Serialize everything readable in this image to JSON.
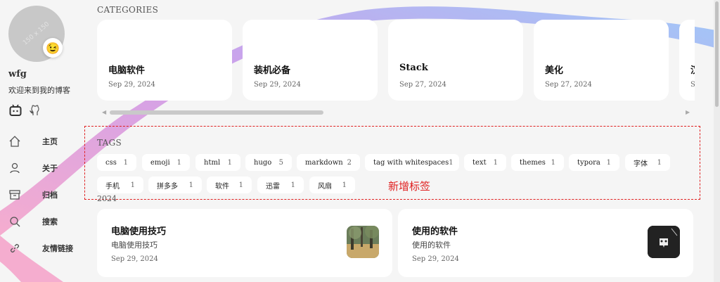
{
  "sidebar": {
    "avatar_placeholder": "150 x 150",
    "emoji": "😉",
    "site_name": "wfg",
    "site_desc": "欢迎来到我的博客",
    "social_icons": [
      "bilibili-icon",
      "github-icon"
    ],
    "nav": [
      {
        "label": "主页",
        "icon": "home-icon"
      },
      {
        "label": "关于",
        "icon": "user-icon"
      },
      {
        "label": "归档",
        "icon": "archive-icon"
      },
      {
        "label": "搜索",
        "icon": "search-icon"
      },
      {
        "label": "友情链接",
        "icon": "link-icon"
      }
    ]
  },
  "categories": {
    "heading": "CATEGORIES",
    "cards": [
      {
        "title": "电脑软件",
        "date": "Sep 29, 2024"
      },
      {
        "title": "装机必备",
        "date": "Sep 29, 2024"
      },
      {
        "title": "Stack",
        "date": "Sep 27, 2024"
      },
      {
        "title": "美化",
        "date": "Sep 27, 2024"
      },
      {
        "title": "汉",
        "date": "S"
      }
    ]
  },
  "tags": {
    "heading": "TAGS",
    "items": [
      {
        "name": "css",
        "count": "1"
      },
      {
        "name": "emoji",
        "count": "1"
      },
      {
        "name": "html",
        "count": "1"
      },
      {
        "name": "hugo",
        "count": "5"
      },
      {
        "name": "markdown",
        "count": "2"
      },
      {
        "name": "tag with whitespaces",
        "count": "1"
      },
      {
        "name": "text",
        "count": "1"
      },
      {
        "name": "themes",
        "count": "1"
      },
      {
        "name": "typora",
        "count": "1"
      },
      {
        "name": "字体",
        "count": "1"
      },
      {
        "name": "手机",
        "count": "1"
      },
      {
        "name": "拼多多",
        "count": "1"
      },
      {
        "name": "软件",
        "count": "1"
      },
      {
        "name": "迅雷",
        "count": "1"
      },
      {
        "name": "风扇",
        "count": "1"
      }
    ],
    "annotation": "新增标签"
  },
  "archive": {
    "year": "2024",
    "articles": [
      {
        "title": "电脑使用技巧",
        "subtitle": "电脑使用技巧",
        "date": "Sep 29, 2024"
      },
      {
        "title": "使用的软件",
        "subtitle": "使用的软件",
        "date": "Sep 29, 2024"
      }
    ]
  },
  "colors": {
    "annotation_red": "#e02020",
    "ribbon_pink": "#f08cc8",
    "ribbon_purple": "#b48cf0",
    "ribbon_blue": "#8cbcf0"
  }
}
